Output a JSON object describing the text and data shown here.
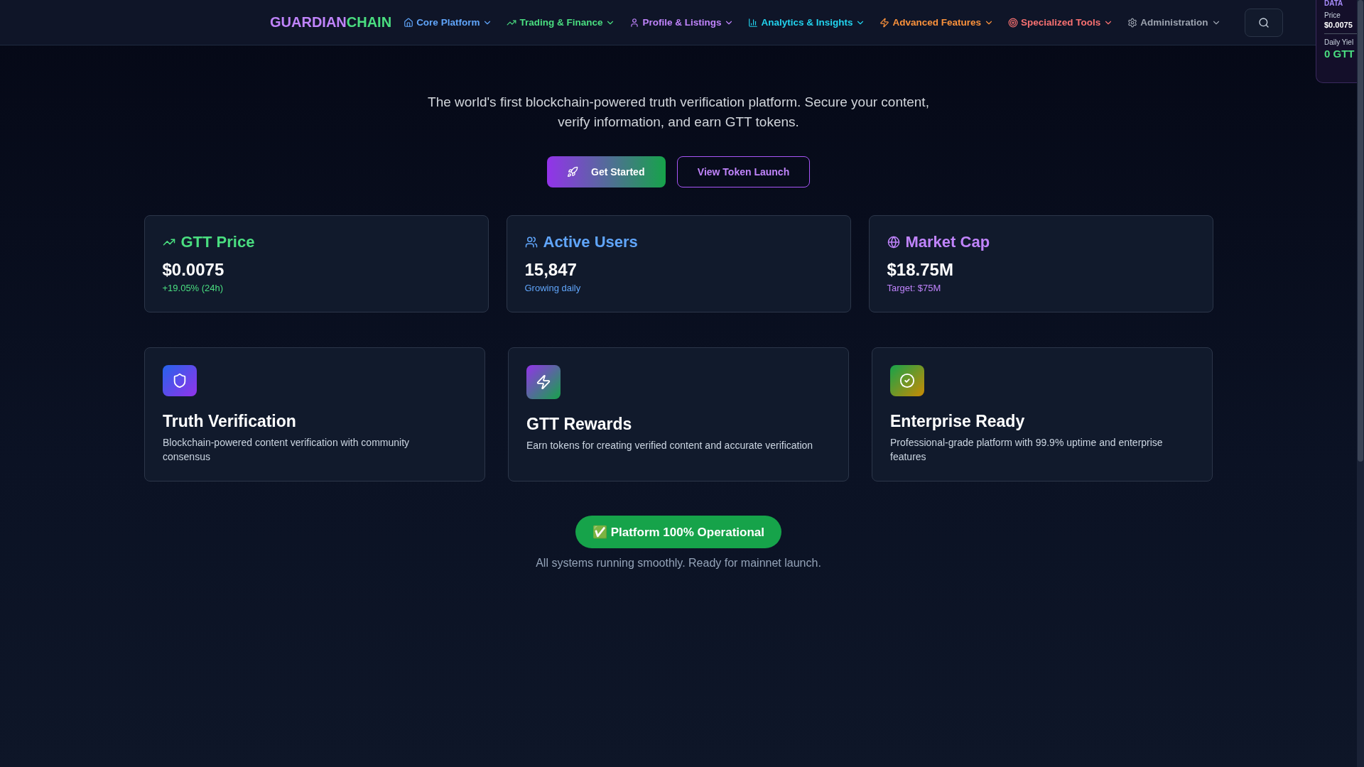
{
  "header": {
    "logo": [
      "GUARDIAN",
      "CHAIN"
    ],
    "nav": [
      {
        "label": "Core Platform",
        "kind": "home",
        "color": "#60a5fa"
      },
      {
        "label": "Trading & Finance",
        "kind": "trend",
        "color": "#4ade80"
      },
      {
        "label": "Profile & Listings",
        "kind": "user",
        "color": "#c084fc"
      },
      {
        "label": "Analytics & Insights",
        "kind": "chart",
        "color": "#22d3ee"
      },
      {
        "label": "Advanced Features",
        "kind": "zap",
        "color": "#fb923c"
      },
      {
        "label": "Specialized Tools",
        "kind": "target",
        "color": "#f87171"
      },
      {
        "label": "Administration",
        "kind": "gear",
        "color": "#9ca3af"
      }
    ]
  },
  "data_widget": {
    "title": "DATA",
    "rows": [
      {
        "label": "Price",
        "value": "$0.0075",
        "kind": "small"
      },
      {
        "label": "Daily Yiel",
        "value": "0 GTT",
        "kind": "big"
      }
    ]
  },
  "hero": {
    "subtitle": "The world's first blockchain-powered truth verification platform. Secure your content, verify information, and earn GTT tokens.",
    "buttons": [
      {
        "label": "Get Started",
        "kind": "primary"
      },
      {
        "label": "View Token Launch",
        "kind": "outline"
      }
    ]
  },
  "stats": [
    {
      "title": "GTT Price",
      "value": "$0.0075",
      "note": "+19.05% (24h)",
      "kind": "trend",
      "color": "#4ade80"
    },
    {
      "title": "Active Users",
      "value": "15,847",
      "note": "Growing daily",
      "kind": "users",
      "color": "#60a5fa"
    },
    {
      "title": "Market Cap",
      "value": "$18.75M",
      "note": "Target: $75M",
      "kind": "globe",
      "color": "#c084fc"
    }
  ],
  "features": [
    {
      "title": "Truth Verification",
      "text": "Blockchain-powered content verification with community consensus",
      "kind": "shield"
    },
    {
      "title": "GTT Rewards",
      "text": "Earn tokens for creating verified content and accurate verification",
      "kind": "zap"
    },
    {
      "title": "Enterprise Ready",
      "text": "Professional-grade platform with 99.9% uptime and enterprise features",
      "kind": "check"
    }
  ],
  "status": {
    "badge": "✅ Platform 100% Operational",
    "caption": "All systems running smoothly. Ready for mainnet launch."
  }
}
